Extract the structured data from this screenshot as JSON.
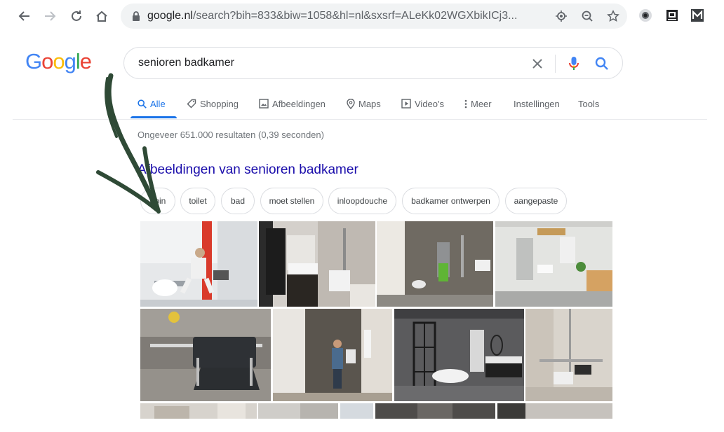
{
  "browser": {
    "url_host": "google.nl",
    "url_path": "/search?bih=833&biw=1058&hl=nl&sxsrf=ALeKk02WGXbikICj3..."
  },
  "logo": {
    "letters": [
      "G",
      "o",
      "o",
      "g",
      "l",
      "e"
    ],
    "colors": [
      "#4285f4",
      "#ea4335",
      "#fbbc05",
      "#4285f4",
      "#34a853",
      "#ea4335"
    ]
  },
  "search": {
    "query": "senioren badkamer"
  },
  "tabs": [
    {
      "label": "Alle",
      "icon": "search-icon",
      "active": true
    },
    {
      "label": "Shopping",
      "icon": "tag-icon"
    },
    {
      "label": "Afbeeldingen",
      "icon": "image-icon"
    },
    {
      "label": "Maps",
      "icon": "map-pin-icon"
    },
    {
      "label": "Video's",
      "icon": "play-icon"
    },
    {
      "label": "Meer",
      "icon": "more-vert-icon"
    },
    {
      "label": "Instellingen"
    },
    {
      "label": "Tools"
    }
  ],
  "results": {
    "stats": "Ongeveer 651.000 resultaten (0,39 seconden)",
    "images_heading": "Afbeeldingen van senioren badkamer"
  },
  "chips": [
    "opin",
    "toilet",
    "bad",
    "moet stellen",
    "inloopdouche",
    "badkamer ontwerpen",
    "aangepaste"
  ],
  "colors": {
    "accent": "#1a73e8",
    "link": "#1a0dab",
    "arrow": "#2f4a36"
  }
}
